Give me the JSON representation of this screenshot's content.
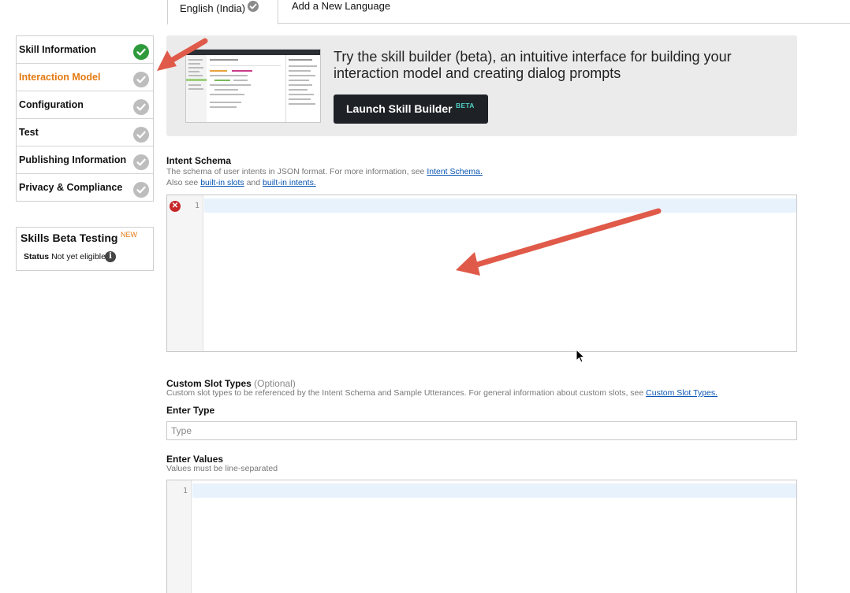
{
  "tabs": {
    "active_label": "English (India)",
    "add_label": "Add a New Language"
  },
  "sidebar": {
    "items": [
      {
        "label": "Skill Information",
        "status": "done"
      },
      {
        "label": "Interaction Model",
        "status": "pending"
      },
      {
        "label": "Configuration",
        "status": "pending"
      },
      {
        "label": "Test",
        "status": "pending"
      },
      {
        "label": "Publishing Information",
        "status": "pending"
      },
      {
        "label": "Privacy & Compliance",
        "status": "pending"
      }
    ],
    "beta_testing": {
      "title": "Skills Beta Testing",
      "badge": "NEW",
      "status_label": "Status",
      "status_value": "Not yet eligible"
    }
  },
  "promo": {
    "text": "Try the skill builder (beta), an intuitive interface for building your interaction model and creating dialog prompts",
    "button_label": "Launch Skill Builder",
    "button_badge": "BETA"
  },
  "intent_schema": {
    "title": "Intent Schema",
    "help_prefix": "The schema of user intents in JSON format. For more information, see",
    "help_link": "Intent Schema.",
    "help2_prefix": "Also see",
    "help2_link1": "built-in slots",
    "help2_and": "and",
    "help2_link2": "built-in intents.",
    "line_number": "1"
  },
  "custom_slot_types": {
    "title": "Custom Slot Types",
    "optional": "(Optional)",
    "help_prefix": "Custom slot types to be referenced by the Intent Schema and Sample Utterances. For general information about custom slots, see",
    "help_link": "Custom Slot Types.",
    "enter_type_label": "Enter Type",
    "type_placeholder": "Type",
    "enter_values_label": "Enter Values",
    "values_help": "Values must be line-separated",
    "line_number": "1"
  },
  "colors": {
    "accent_orange": "#e47911",
    "complete_green": "#2e9a3c",
    "link_blue": "#0a55b3",
    "annotation_arrow": "#e05a4a"
  }
}
